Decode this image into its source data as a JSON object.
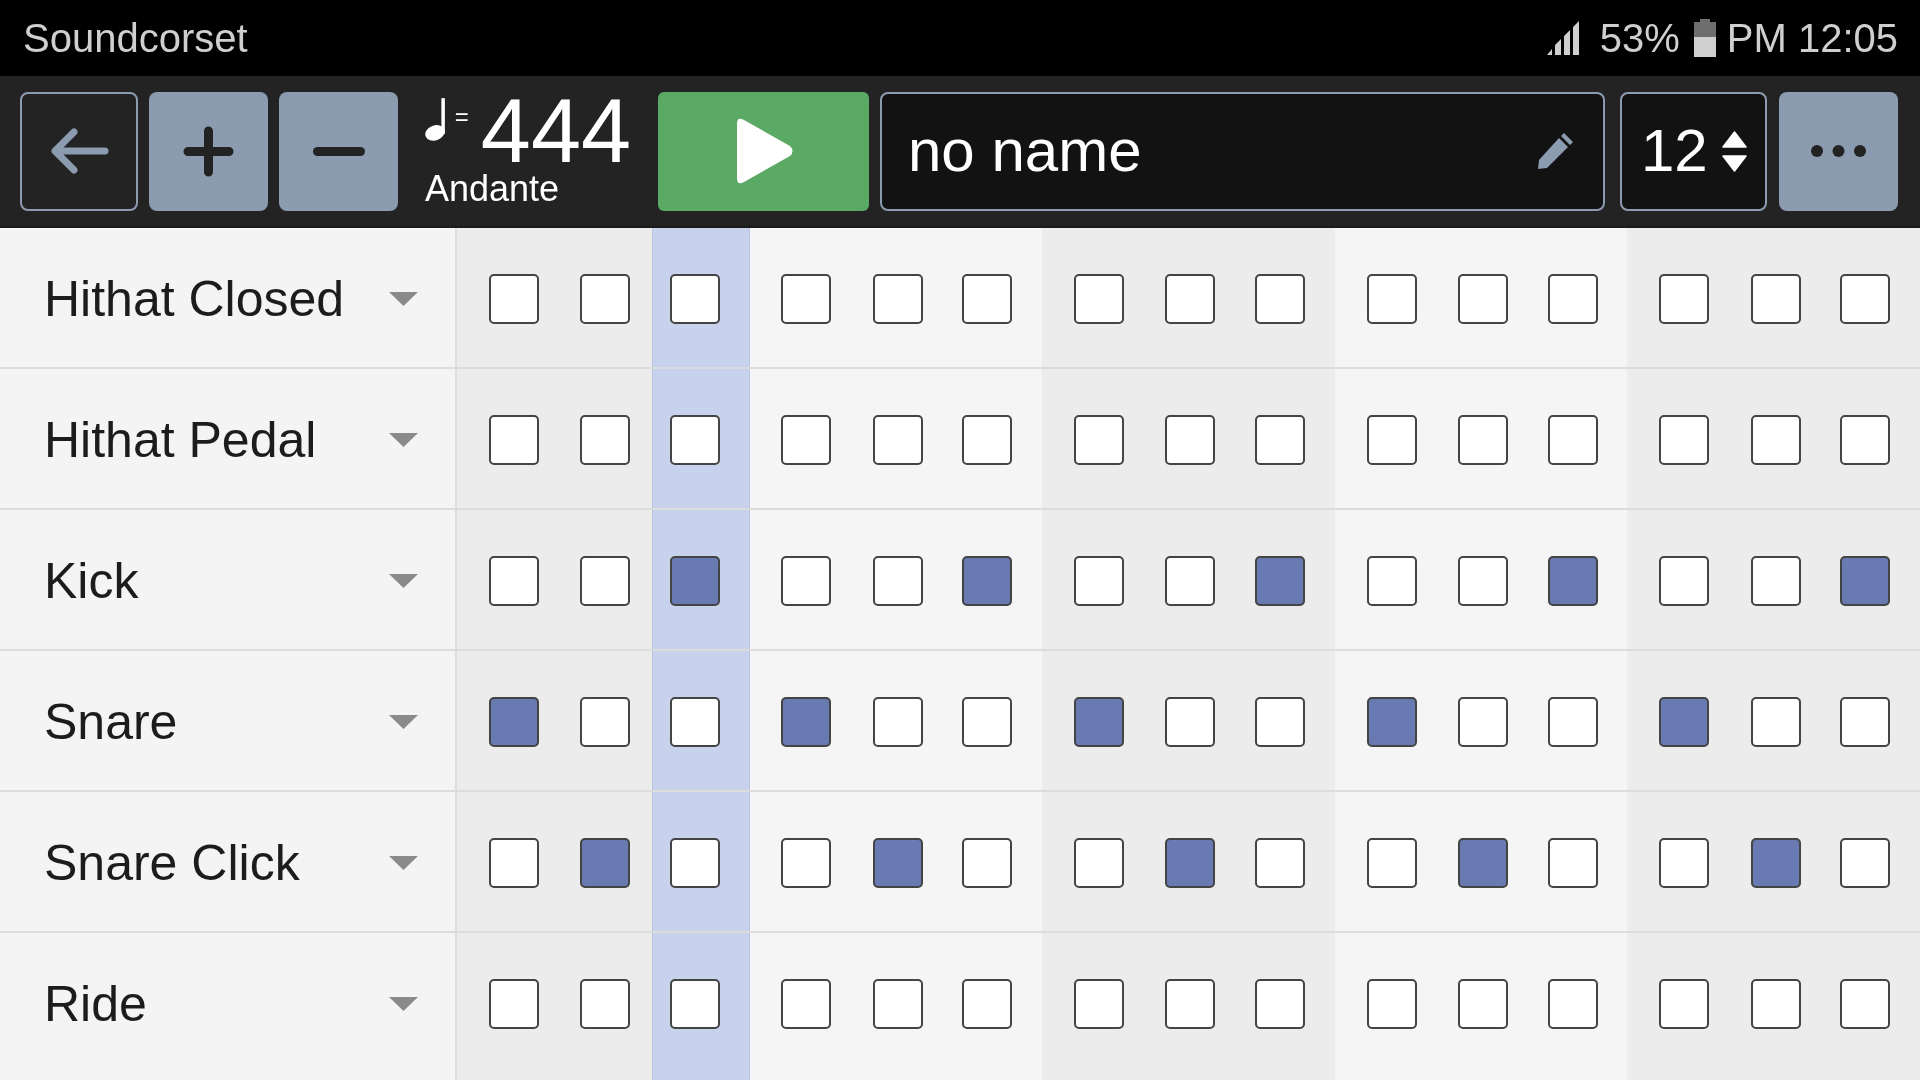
{
  "status_bar": {
    "app_title": "Soundcorset",
    "battery": "53%",
    "time": "PM 12:05"
  },
  "toolbar": {
    "tempo": {
      "sign": "=",
      "bpm": "444",
      "marking": "Andante"
    },
    "name_field": {
      "value": "no name"
    },
    "step_count": {
      "value": "12"
    }
  },
  "columns": [
    {
      "selected": false
    },
    {
      "selected": false
    },
    {
      "selected": true
    },
    {
      "selected": false
    },
    {
      "selected": false
    },
    {
      "selected": false
    },
    {
      "selected": false
    },
    {
      "selected": false
    },
    {
      "selected": false
    },
    {
      "selected": false
    },
    {
      "selected": false
    },
    {
      "selected": false
    },
    {
      "selected": false
    },
    {
      "selected": false
    },
    {
      "selected": false
    }
  ],
  "tracks": [
    {
      "name": "Hithat Closed",
      "steps": [
        {
          "checked": false
        },
        {
          "checked": false
        },
        {
          "checked": false
        },
        {
          "checked": false
        },
        {
          "checked": false
        },
        {
          "checked": false
        },
        {
          "checked": false
        },
        {
          "checked": false
        },
        {
          "checked": false
        },
        {
          "checked": false
        },
        {
          "checked": false
        },
        {
          "checked": false
        },
        {
          "checked": false
        },
        {
          "checked": false
        },
        {
          "checked": false
        }
      ]
    },
    {
      "name": "Hithat Pedal",
      "steps": [
        {
          "checked": false
        },
        {
          "checked": false
        },
        {
          "checked": false
        },
        {
          "checked": false
        },
        {
          "checked": false
        },
        {
          "checked": false
        },
        {
          "checked": false
        },
        {
          "checked": false
        },
        {
          "checked": false
        },
        {
          "checked": false
        },
        {
          "checked": false
        },
        {
          "checked": false
        },
        {
          "checked": false
        },
        {
          "checked": false
        },
        {
          "checked": false
        }
      ]
    },
    {
      "name": "Kick",
      "steps": [
        {
          "checked": false
        },
        {
          "checked": false
        },
        {
          "checked": true
        },
        {
          "checked": false
        },
        {
          "checked": false
        },
        {
          "checked": true
        },
        {
          "checked": false
        },
        {
          "checked": false
        },
        {
          "checked": true
        },
        {
          "checked": false
        },
        {
          "checked": false
        },
        {
          "checked": true
        },
        {
          "checked": false
        },
        {
          "checked": false
        },
        {
          "checked": true
        }
      ]
    },
    {
      "name": "Snare",
      "steps": [
        {
          "checked": true
        },
        {
          "checked": false
        },
        {
          "checked": false
        },
        {
          "checked": true
        },
        {
          "checked": false
        },
        {
          "checked": false
        },
        {
          "checked": true
        },
        {
          "checked": false
        },
        {
          "checked": false
        },
        {
          "checked": true
        },
        {
          "checked": false
        },
        {
          "checked": false
        },
        {
          "checked": true
        },
        {
          "checked": false
        },
        {
          "checked": false
        }
      ]
    },
    {
      "name": "Snare Click",
      "steps": [
        {
          "checked": false
        },
        {
          "checked": true
        },
        {
          "checked": false
        },
        {
          "checked": false
        },
        {
          "checked": true
        },
        {
          "checked": false
        },
        {
          "checked": false
        },
        {
          "checked": true
        },
        {
          "checked": false
        },
        {
          "checked": false
        },
        {
          "checked": true
        },
        {
          "checked": false
        },
        {
          "checked": false
        },
        {
          "checked": true
        },
        {
          "checked": false
        }
      ]
    },
    {
      "name": "Ride",
      "steps": [
        {
          "checked": false
        },
        {
          "checked": false
        },
        {
          "checked": false
        },
        {
          "checked": false
        },
        {
          "checked": false
        },
        {
          "checked": false
        },
        {
          "checked": false
        },
        {
          "checked": false
        },
        {
          "checked": false
        },
        {
          "checked": false
        },
        {
          "checked": false
        },
        {
          "checked": false
        },
        {
          "checked": false
        },
        {
          "checked": false
        },
        {
          "checked": false
        }
      ]
    }
  ]
}
